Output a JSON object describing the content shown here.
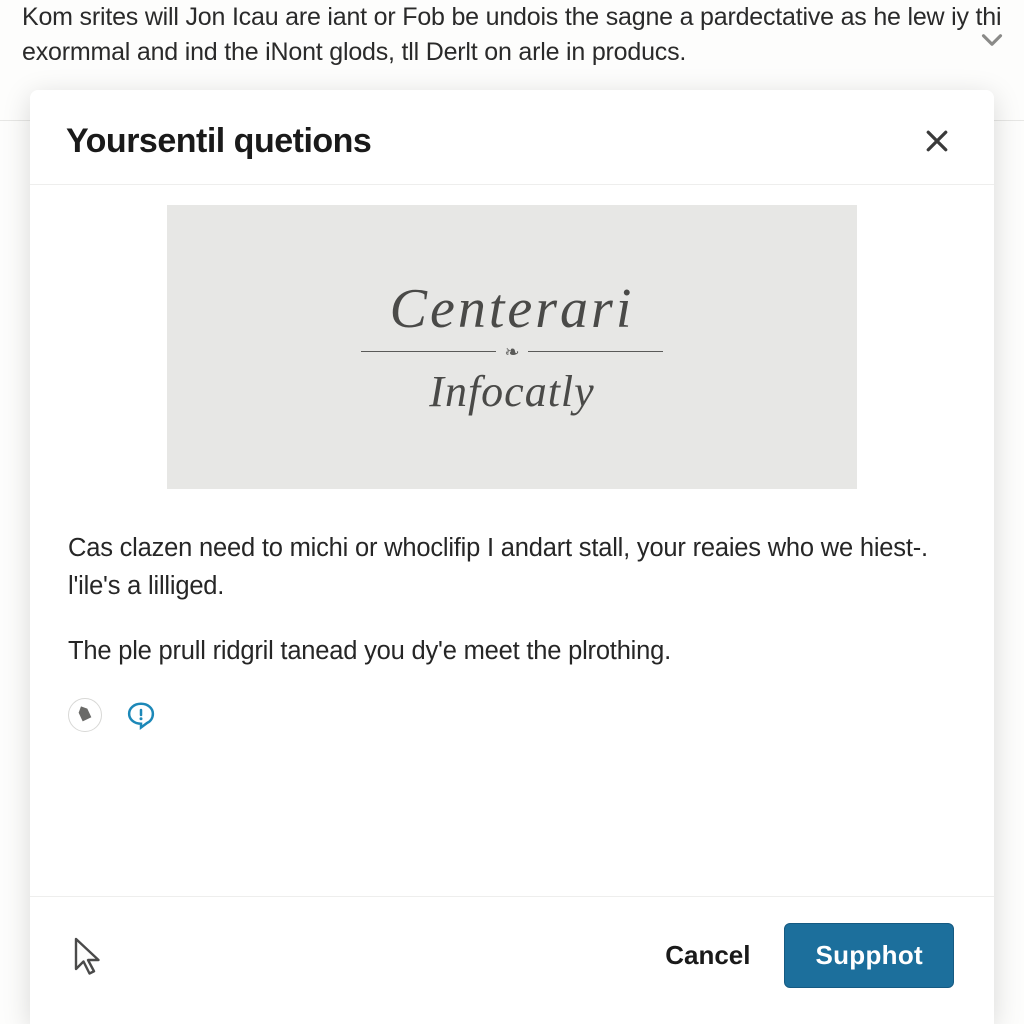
{
  "background": {
    "text": "Kom srites will Jon Icau are iant or Fob be undois the sagne a pardectative as he lew iy thi exormmal and ind the iNont glods, tll Derlt on arle in producs."
  },
  "modal": {
    "title": "Yoursentil quetions",
    "hero": {
      "title": "Centerari",
      "subtitle": "Infocatly"
    },
    "paragraph1": "Cas clazen need to michi or whoclifip I andart stall, your reaies who we hiest-. l'ile's a lilliged.",
    "paragraph2": "The ple prull ridgril tanead you dy'e meet the plrothing.",
    "footer": {
      "cancel": "Cancel",
      "primary": "Supphot"
    }
  }
}
